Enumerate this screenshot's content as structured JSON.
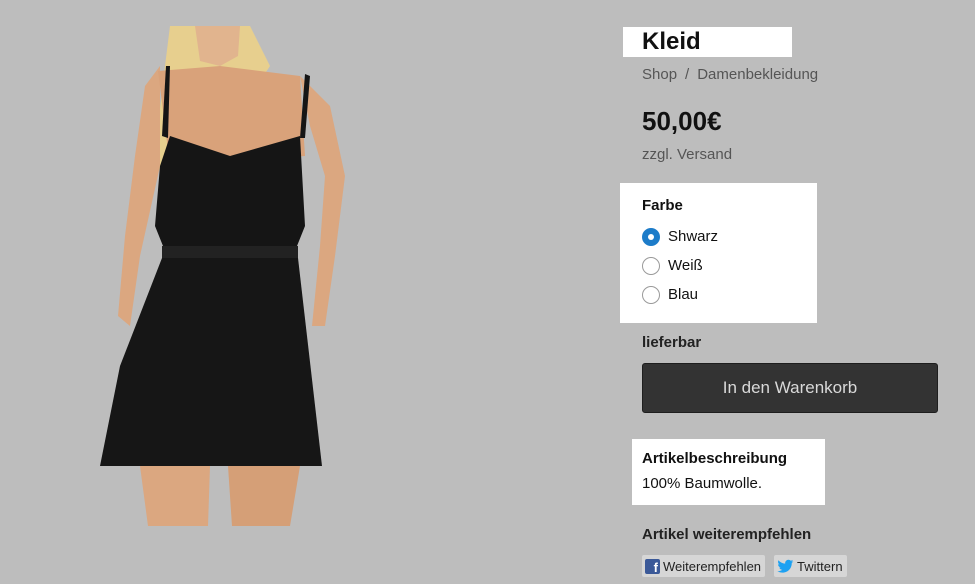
{
  "product": {
    "title": "Kleid",
    "price": "50,00€",
    "shipping_note": "zzgl. Versand",
    "image_icon": "dress-photo"
  },
  "breadcrumb": {
    "items": [
      "Shop",
      "Damenbekleidung"
    ],
    "separator": "/"
  },
  "color_options": {
    "heading": "Farbe",
    "options": [
      {
        "label": "Shwarz",
        "selected": true
      },
      {
        "label": "Weiß",
        "selected": false
      },
      {
        "label": "Blau",
        "selected": false
      }
    ]
  },
  "availability": "lieferbar",
  "cart": {
    "button_label": "In den Warenkorb"
  },
  "description": {
    "heading": "Artikelbeschreibung",
    "text": "100% Baumwolle."
  },
  "share": {
    "heading": "Artikel weiterempfehlen",
    "facebook_label": "Weiterempfehlen",
    "twitter_label": "Twittern",
    "facebook_icon": "facebook-icon",
    "twitter_icon": "twitter-icon"
  },
  "colors": {
    "background": "#bdbdbd",
    "button_bg": "#333333",
    "radio_accent": "#1d7cc9",
    "facebook_blue": "#3b5998",
    "twitter_blue": "#1da1f2"
  }
}
